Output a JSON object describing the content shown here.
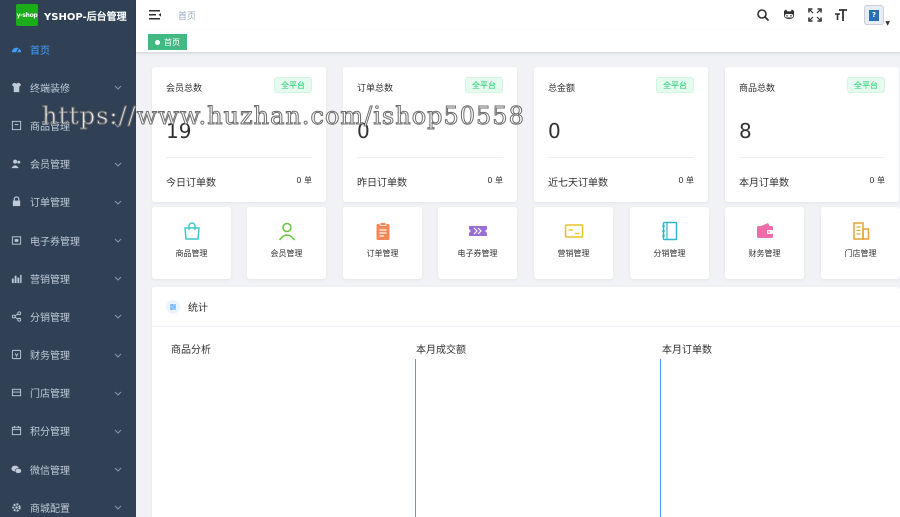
{
  "app": {
    "logo_text": "y-shop",
    "title": "YSHOP-后台管理"
  },
  "sidebar": {
    "items": [
      {
        "label": "首页",
        "icon": "dashboard-icon",
        "active": true
      },
      {
        "label": "终端装修",
        "icon": "shirt-icon"
      },
      {
        "label": "商品管理",
        "icon": "goods-icon"
      },
      {
        "label": "会员管理",
        "icon": "users-icon"
      },
      {
        "label": "订单管理",
        "icon": "lock-icon"
      },
      {
        "label": "电子券管理",
        "icon": "coupon-icon"
      },
      {
        "label": "营销管理",
        "icon": "chart-icon"
      },
      {
        "label": "分销管理",
        "icon": "share-icon"
      },
      {
        "label": "财务管理",
        "icon": "money-icon"
      },
      {
        "label": "门店管理",
        "icon": "store-icon"
      },
      {
        "label": "积分管理",
        "icon": "calendar-icon"
      },
      {
        "label": "微信管理",
        "icon": "wechat-icon"
      },
      {
        "label": "商城配置",
        "icon": "gear-icon"
      }
    ]
  },
  "navbar": {
    "breadcrumb": "首页"
  },
  "tags": {
    "active_tag": "首页"
  },
  "stats": [
    {
      "label": "会员总数",
      "badge": "全平台",
      "value": "19",
      "sub_label": "今日订单数",
      "sub_value": "0 单"
    },
    {
      "label": "订单总数",
      "badge": "全平台",
      "value": "0",
      "sub_label": "昨日订单数",
      "sub_value": "0 单"
    },
    {
      "label": "总金额",
      "badge": "全平台",
      "value": "0",
      "sub_label": "近七天订单数",
      "sub_value": "0 单"
    },
    {
      "label": "商品总数",
      "badge": "全平台",
      "value": "8",
      "sub_label": "本月订单数",
      "sub_value": "0 单"
    }
  ],
  "shortcuts": [
    {
      "label": "商品管理",
      "icon": "bag-icon",
      "color": "#40c9c6"
    },
    {
      "label": "会员管理",
      "icon": "user-icon",
      "color": "#67c23a"
    },
    {
      "label": "订单管理",
      "icon": "clipboard-icon",
      "color": "#f4875a"
    },
    {
      "label": "电子券管理",
      "icon": "ticket-icon",
      "color": "#9b6ed6"
    },
    {
      "label": "营销管理",
      "icon": "card-icon",
      "color": "#e6c229"
    },
    {
      "label": "分销管理",
      "icon": "notebook-icon",
      "color": "#2fb8c9"
    },
    {
      "label": "财务管理",
      "icon": "wallet-icon",
      "color": "#f06ca8"
    },
    {
      "label": "门店管理",
      "icon": "building-icon",
      "color": "#e6a23c"
    }
  ],
  "statistics": {
    "title": "统计",
    "columns": [
      "商品分析",
      "本月成交额",
      "本月订单数"
    ]
  },
  "watermark": "https://www.huzhan.com/ishop50558",
  "colors": {
    "sidebar_bg": "#304156",
    "active": "#409eff",
    "badge_green": "#13ce66",
    "tag_green": "#42b983"
  }
}
